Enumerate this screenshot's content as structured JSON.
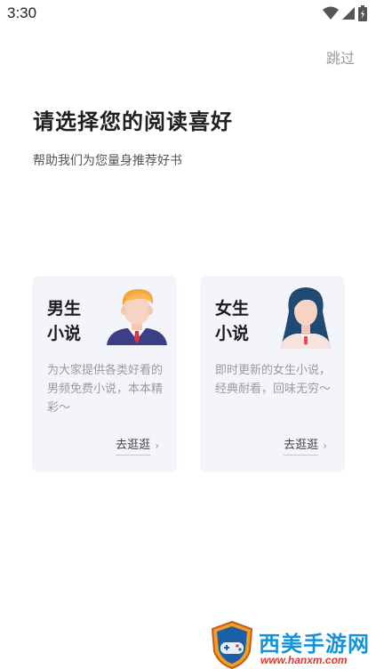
{
  "status_bar": {
    "time": "3:30",
    "icons": [
      "wifi-icon",
      "signal-icon",
      "battery-icon"
    ]
  },
  "header": {
    "skip_label": "跳过",
    "title": "请选择您的阅读喜好",
    "subtitle": "帮助我们为您量身推荐好书"
  },
  "cards": [
    {
      "title_line1": "男生",
      "title_line2": "小说",
      "avatar": "male-avatar-icon",
      "description": "为大家提供各类好看的男频免费小说，本本精彩～",
      "link_label": "去逛逛"
    },
    {
      "title_line1": "女生",
      "title_line2": "小说",
      "avatar": "female-avatar-icon",
      "description": "即时更新的女生小说，经典耐看，回味无穷～",
      "link_label": "去逛逛"
    }
  ],
  "watermark": {
    "name": "西美手游网",
    "url": "www.hanxm.com"
  },
  "colors": {
    "card_background": "#f4f5fa",
    "watermark_blue": "#1693d8",
    "watermark_red": "#e6332a"
  }
}
